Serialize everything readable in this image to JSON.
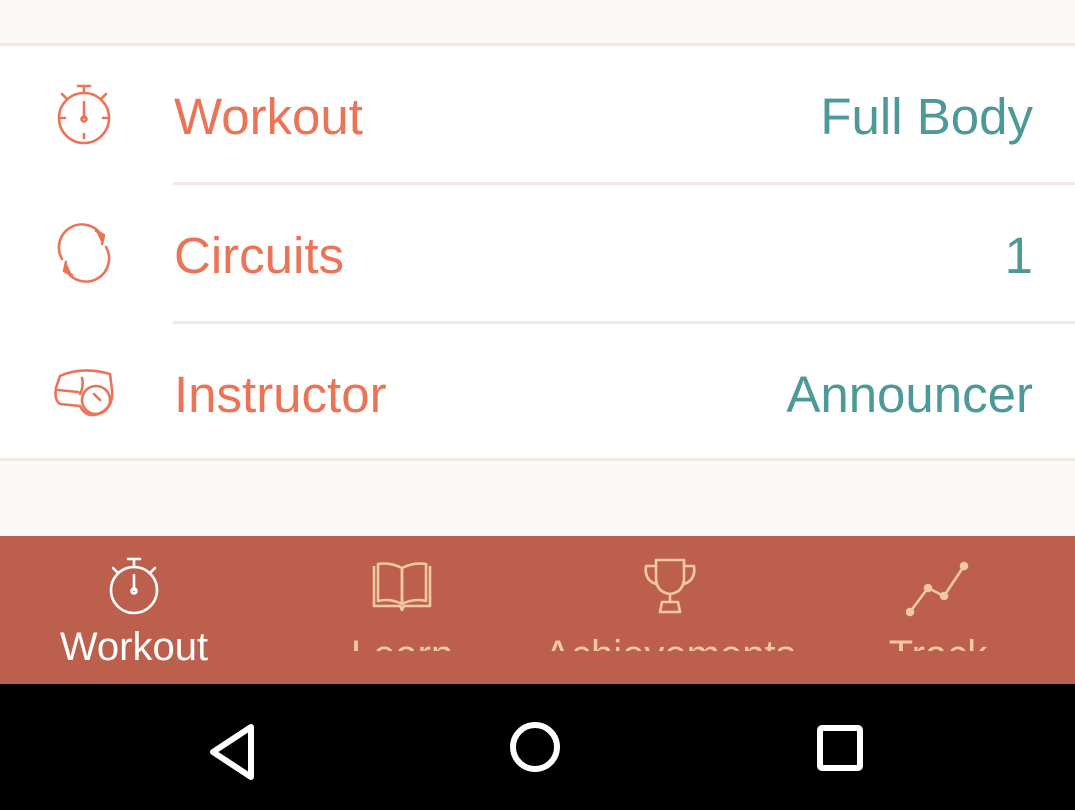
{
  "settings": {
    "rows": [
      {
        "label": "Workout",
        "value": "Full Body",
        "icon": "stopwatch-icon"
      },
      {
        "label": "Circuits",
        "value": "1",
        "icon": "refresh-icon"
      },
      {
        "label": "Instructor",
        "value": "Announcer",
        "icon": "whistle-icon"
      }
    ]
  },
  "tabs": [
    {
      "label": "Workout",
      "icon": "stopwatch-icon",
      "active": true
    },
    {
      "label": "Learn",
      "icon": "book-icon",
      "active": false
    },
    {
      "label": "Achievements",
      "icon": "trophy-icon",
      "active": false
    },
    {
      "label": "Track",
      "icon": "line-chart-icon",
      "active": false
    }
  ],
  "navbar": {
    "buttons": [
      "back-icon",
      "home-icon",
      "recents-icon"
    ]
  },
  "colors": {
    "label": "#eb7456",
    "value": "#4c9a97",
    "tab_bar": "#bd5f4d",
    "tab_active": "#ffffff",
    "tab_inactive": "#f1c9a0",
    "background": "#fbf9f7"
  }
}
